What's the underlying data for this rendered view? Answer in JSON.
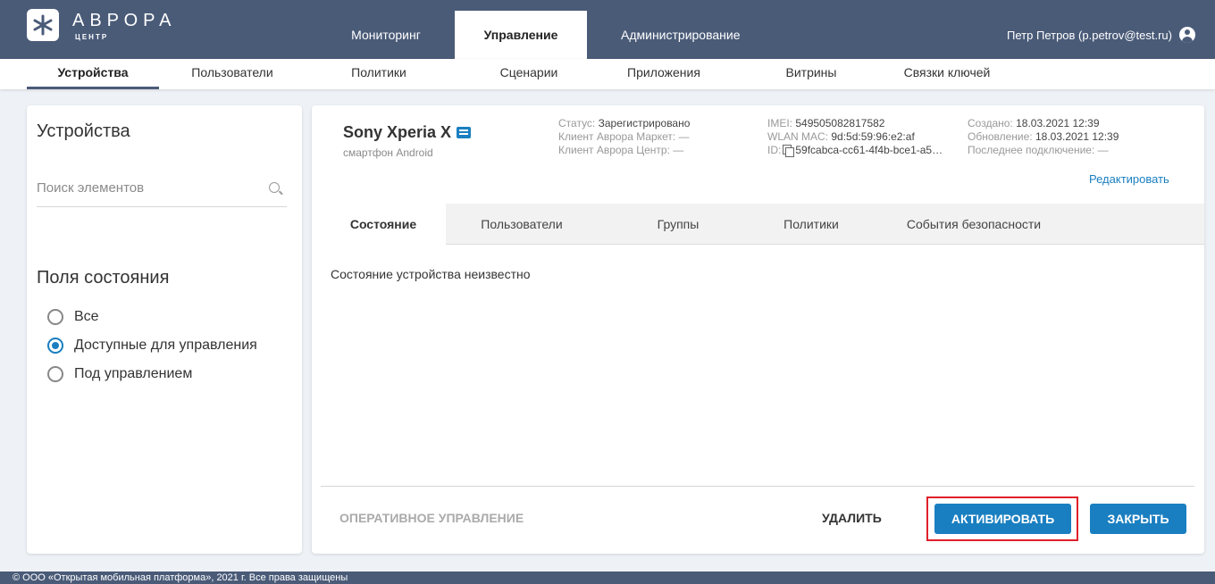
{
  "brand": {
    "name": "АВРОРА",
    "subtitle": "ЦЕНТР"
  },
  "main_tabs": [
    {
      "label": "Мониторинг",
      "active": false
    },
    {
      "label": "Управление",
      "active": true
    },
    {
      "label": "Администрирование",
      "active": false
    }
  ],
  "user": {
    "label": "Петр Петров (p.petrov@test.ru)",
    "icon": "user-circle-icon"
  },
  "sub_tabs": [
    {
      "label": "Устройства",
      "active": true
    },
    {
      "label": "Пользователи",
      "active": false
    },
    {
      "label": "Политики",
      "active": false
    },
    {
      "label": "Сценарии",
      "active": false
    },
    {
      "label": "Приложения",
      "active": false
    },
    {
      "label": "Витрины",
      "active": false
    },
    {
      "label": "Связки ключей",
      "active": false
    }
  ],
  "left_panel": {
    "title": "Устройства",
    "search_placeholder": "Поиск элементов",
    "fields_title": "Поля состояния",
    "filters": [
      {
        "label": "Все",
        "checked": false
      },
      {
        "label": "Доступные для управления",
        "checked": true
      },
      {
        "label": "Под управлением",
        "checked": false
      }
    ]
  },
  "device": {
    "name": "Sony Xperia X",
    "type": "смартфон Android",
    "status_label": "Статус:",
    "status_value": "Зарегистрировано",
    "market_label": "Клиент Аврора Маркет:",
    "market_value": "—",
    "center_label": "Клиент Аврора Центр:",
    "center_value": "—",
    "imei_label": "IMEI:",
    "imei_value": "549505082817582",
    "wlan_label": "WLAN MAC:",
    "wlan_value": "9d:5d:59:96:e2:af",
    "id_label": "ID:",
    "id_value": "59fcabca-cc61-4f4b-bce1-a5…",
    "created_label": "Создано:",
    "created_value": "18.03.2021 12:39",
    "updated_label": "Обновление:",
    "updated_value": "18.03.2021 12:39",
    "last_conn_label": "Последнее подключение:",
    "last_conn_value": "—",
    "edit_label": "Редактировать"
  },
  "device_tabs": [
    {
      "label": "Состояние",
      "active": true
    },
    {
      "label": "Пользователи",
      "active": false
    },
    {
      "label": "Группы",
      "active": false
    },
    {
      "label": "Политики",
      "active": false
    },
    {
      "label": "События безопасности",
      "active": false
    }
  ],
  "state_text": "Состояние устройства неизвестно",
  "actions": {
    "ops": "ОПЕРАТИВНОЕ УПРАВЛЕНИЕ",
    "delete": "УДАЛИТЬ",
    "activate": "АКТИВИРОВАТЬ",
    "close": "ЗАКРЫТЬ"
  },
  "footer": "© ООО «Открытая мобильная платформа», 2021 г. Все права защищены",
  "colors": {
    "header": "#4a5b78",
    "accent": "#1a7fc1",
    "highlight": "#e0202a"
  }
}
